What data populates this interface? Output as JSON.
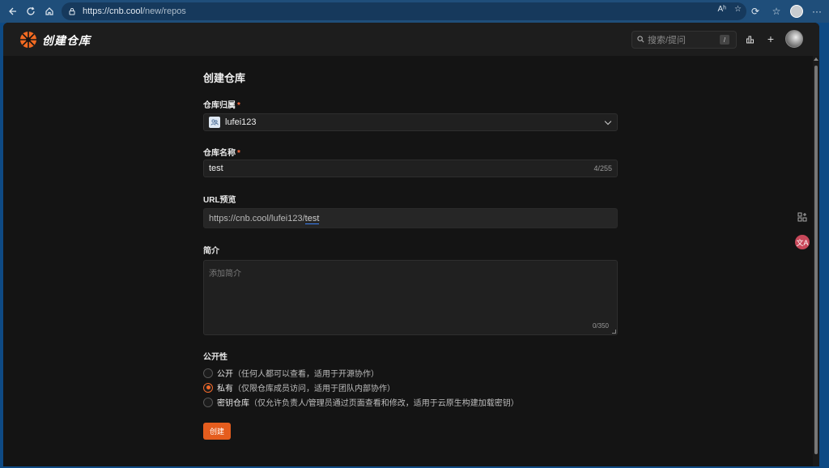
{
  "browser": {
    "url_host": "https://cnb.cool",
    "url_path": "/new/repos",
    "reader_label": "Aʰ"
  },
  "app": {
    "brand": "创建仓库",
    "search_placeholder": "搜索/提问",
    "search_shortcut": "/"
  },
  "form": {
    "title": "创建仓库",
    "owner_label": "仓库归属",
    "owner_value": "lufei123",
    "name_label": "仓库名称",
    "name_value": "test",
    "name_counter": "4/255",
    "url_label": "URL预览",
    "url_prefix": "https://cnb.cool/lufei123/",
    "url_slug": "test",
    "desc_label": "简介",
    "desc_placeholder": "添加简介",
    "desc_counter": "0/350",
    "visibility_label": "公开性",
    "visibility_options": [
      {
        "label": "公开",
        "hint": "（任何人都可以查看，适用于开源协作）",
        "selected": false
      },
      {
        "label": "私有",
        "hint": "（仅限仓库成员访问，适用于团队内部协作）",
        "selected": true
      },
      {
        "label": "密钥仓库",
        "hint": "（仅允许负责人/管理员通过页面查看和修改，适用于云原生构建加载密钥）",
        "selected": false
      }
    ],
    "submit_label": "创建"
  },
  "colors": {
    "accent": "#e55d1e",
    "background": "#141414",
    "header": "#1d1d1d"
  },
  "icons": [
    "back-icon",
    "refresh-icon",
    "home-icon",
    "lock-icon",
    "read-aloud-icon",
    "favorite-icon",
    "extensions-icon",
    "favorites-list-icon",
    "more-icon",
    "search-icon",
    "stats-icon",
    "plus-icon",
    "chevron-down-icon",
    "group-icon",
    "apps-icon",
    "translate-icon"
  ]
}
